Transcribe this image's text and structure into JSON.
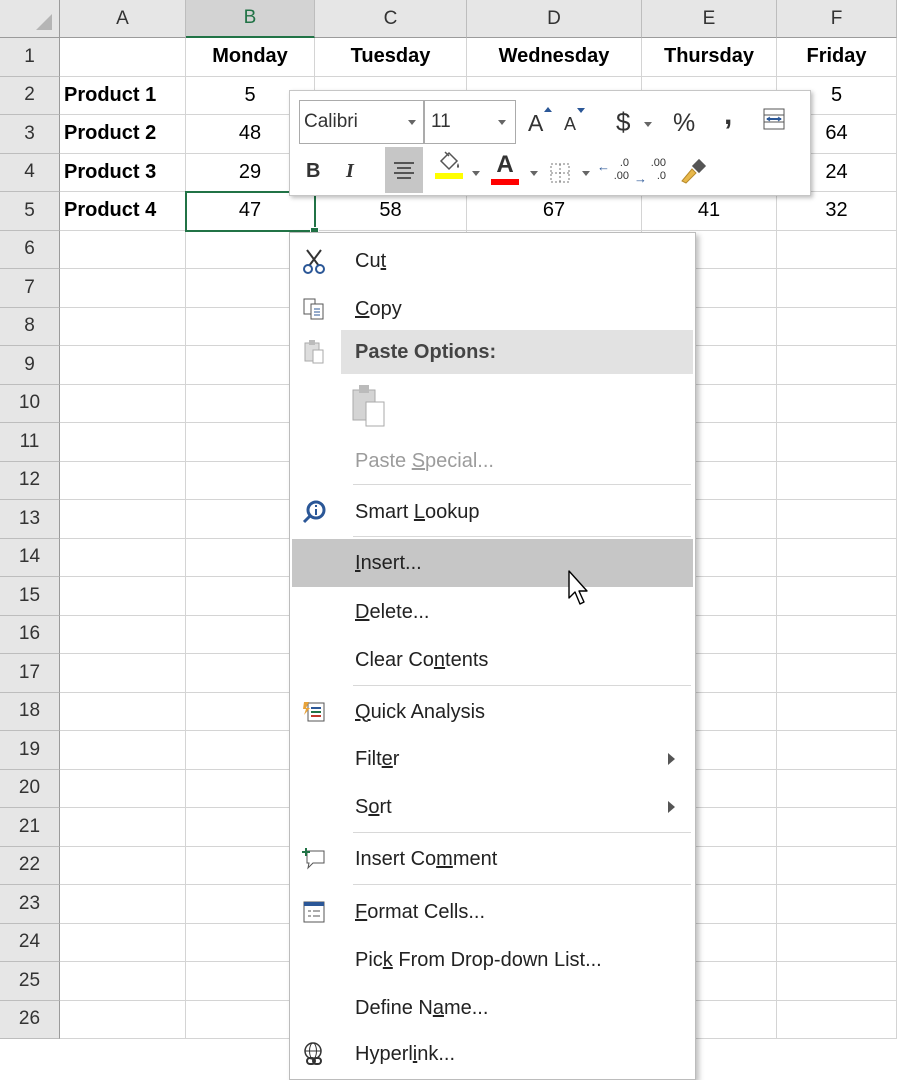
{
  "columns": [
    "A",
    "B",
    "C",
    "D",
    "E",
    "F"
  ],
  "selected_column": "B",
  "rows": [
    "1",
    "2",
    "3",
    "4",
    "5",
    "6",
    "7",
    "8",
    "9",
    "10",
    "11",
    "12",
    "13",
    "14",
    "15",
    "16",
    "17",
    "18",
    "19",
    "20",
    "21",
    "22",
    "23",
    "24",
    "25",
    "26"
  ],
  "header_row": [
    "",
    "Monday",
    "Tuesday",
    "Wednesday",
    "Thursday",
    "Friday"
  ],
  "data_rows": [
    [
      "Product 1",
      "5",
      "",
      "",
      "",
      "5"
    ],
    [
      "Product 2",
      "48",
      "",
      "",
      "",
      "64"
    ],
    [
      "Product 3",
      "29",
      "",
      "",
      "",
      "24"
    ],
    [
      "Product 4",
      "47",
      "58",
      "67",
      "41",
      "32"
    ]
  ],
  "active_cell": "B5",
  "mini_toolbar": {
    "font_name": "Calibri",
    "font_size": "11",
    "increase_font": "A",
    "decrease_font": "A",
    "currency": "$",
    "percent": "%",
    "comma": ",",
    "bold": "B",
    "italic": "I",
    "font_color": "A",
    "inc_decimal_top": ".0",
    "inc_decimal_bottom": ".00",
    "dec_decimal_top": ".00",
    "dec_decimal_bottom": ".0",
    "colors": {
      "fill_highlight": "#ffff00",
      "font_red": "#ff0000",
      "brush": "#e8b84a"
    }
  },
  "context_menu": {
    "cut": {
      "pre": "Cu",
      "ul": "t",
      "post": ""
    },
    "copy": {
      "pre": "",
      "ul": "C",
      "post": "opy"
    },
    "paste_options": "Paste Options:",
    "paste_special": {
      "pre": "Paste ",
      "ul": "S",
      "post": "pecial..."
    },
    "smart_lookup": {
      "pre": "Smart ",
      "ul": "L",
      "post": "ookup"
    },
    "insert": {
      "pre": "",
      "ul": "I",
      "post": "nsert..."
    },
    "delete": {
      "pre": "",
      "ul": "D",
      "post": "elete..."
    },
    "clear_contents": {
      "pre": "Clear Co",
      "ul": "n",
      "post": "tents"
    },
    "quick_analysis": {
      "pre": "",
      "ul": "Q",
      "post": "uick Analysis"
    },
    "filter": {
      "pre": "Filt",
      "ul": "e",
      "post": "r"
    },
    "sort": {
      "pre": "S",
      "ul": "o",
      "post": "rt"
    },
    "insert_comment": {
      "pre": "Insert Co",
      "ul": "m",
      "post": "ment"
    },
    "format_cells": {
      "pre": "",
      "ul": "F",
      "post": "ormat Cells..."
    },
    "pick_dropdown": {
      "pre": "Pic",
      "ul": "k",
      "post": " From Drop-down List..."
    },
    "define_name": {
      "pre": "Define N",
      "ul": "a",
      "post": "me..."
    },
    "hyperlink": {
      "pre": "Hyperl",
      "ul": "i",
      "post": "nk..."
    }
  },
  "theme": {
    "excel_green": "#217346",
    "header_bg": "#e6e6e6",
    "highlight": "#c6c6c6"
  }
}
